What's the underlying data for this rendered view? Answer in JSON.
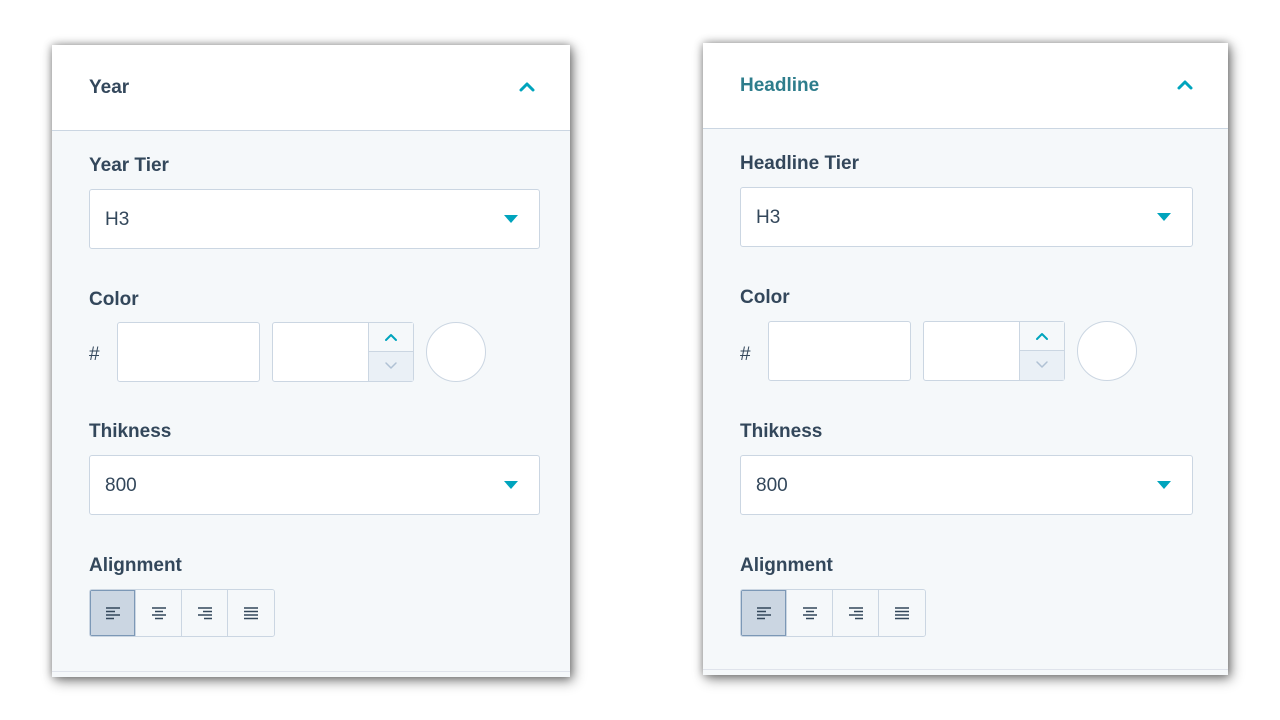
{
  "colors": {
    "accent": "#00a4bd",
    "text": "#33475b",
    "border": "#cbd6e2",
    "panel_bg": "#f5f8fa",
    "header_title_right": "#2e7d8c"
  },
  "panels": [
    {
      "header": {
        "title": "Year",
        "icon": "chevron-up-icon"
      },
      "tier": {
        "label": "Year Tier",
        "value": "H3"
      },
      "color": {
        "label": "Color",
        "hash": "#",
        "hex_value": "",
        "opacity_value": ""
      },
      "thickness": {
        "label": "Thikness",
        "value": "800"
      },
      "alignment": {
        "label": "Alignment",
        "options": [
          "left",
          "center",
          "right",
          "justify"
        ],
        "selected": "left"
      }
    },
    {
      "header": {
        "title": "Headline",
        "icon": "chevron-up-icon"
      },
      "tier": {
        "label": "Headline Tier",
        "value": "H3"
      },
      "color": {
        "label": "Color",
        "hash": "#",
        "hex_value": "",
        "opacity_value": ""
      },
      "thickness": {
        "label": "Thikness",
        "value": "800"
      },
      "alignment": {
        "label": "Alignment",
        "options": [
          "left",
          "center",
          "right",
          "justify"
        ],
        "selected": "left"
      }
    }
  ]
}
